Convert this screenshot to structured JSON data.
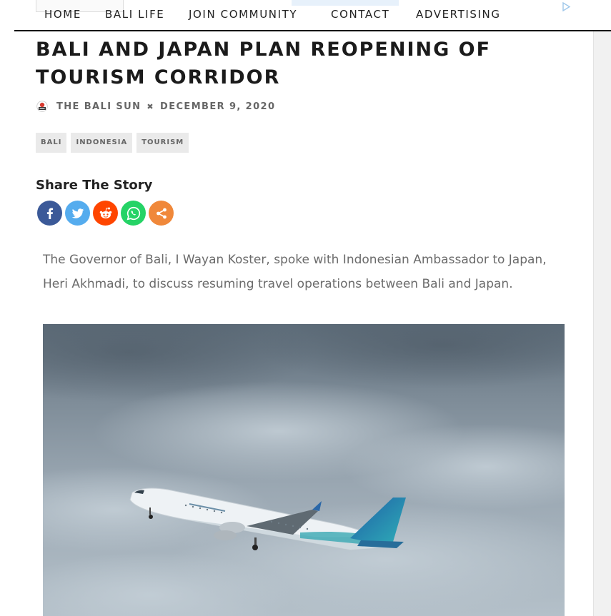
{
  "nav": {
    "items": [
      {
        "label": "HOME"
      },
      {
        "label": "BALI LIFE"
      },
      {
        "label": "JOIN COMMUNITY"
      },
      {
        "label": "CONTACT"
      },
      {
        "label": "ADVERTISING"
      }
    ]
  },
  "article": {
    "title": "BALI AND JAPAN PLAN REOPENING OF TOURISM CORRIDOR",
    "author": "THE BALI SUN",
    "date": "DECEMBER 9, 2020",
    "tags": [
      "BALI",
      "INDONESIA",
      "TOURISM"
    ],
    "lede": "The Governor of Bali, I Wayan Koster, spoke with Indonesian Ambassador to Japan, Heri Akhmadi, to discuss resuming travel operations between Bali and Japan.",
    "image_alt": "Garuda Indonesia plane taking off under a cloudy sky"
  },
  "share": {
    "heading": "Share The Story",
    "buttons": [
      {
        "network": "facebook",
        "icon": "facebook-icon",
        "color": "#3b5998"
      },
      {
        "network": "twitter",
        "icon": "twitter-icon",
        "color": "#55acee"
      },
      {
        "network": "reddit",
        "icon": "reddit-icon",
        "color": "#ff4500"
      },
      {
        "network": "whatsapp",
        "icon": "whatsapp-icon",
        "color": "#25d366"
      },
      {
        "network": "more",
        "icon": "share-icon",
        "color": "#f0883a"
      }
    ]
  },
  "colors": {
    "nav_border": "#111111",
    "tag_bg": "#eaeaea",
    "text_muted": "#6b6b6b"
  }
}
